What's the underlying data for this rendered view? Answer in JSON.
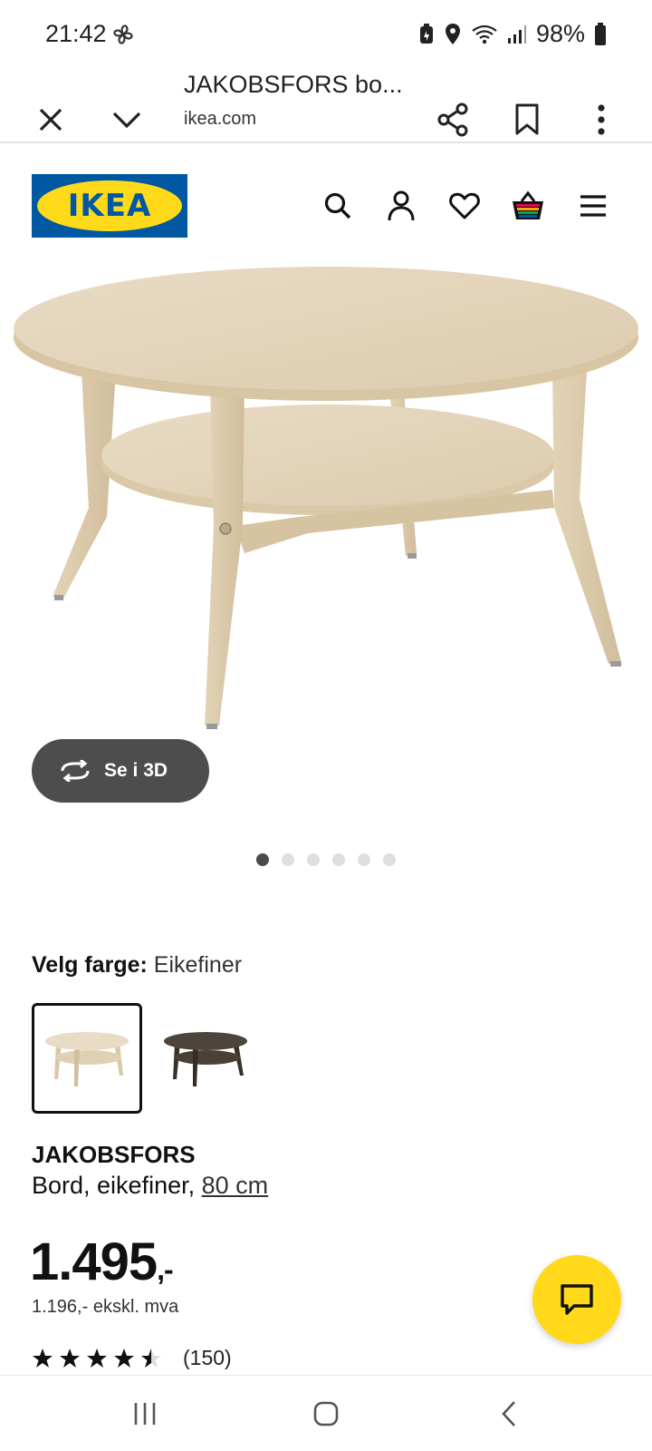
{
  "status_bar": {
    "time": "21:42",
    "battery": "98%"
  },
  "browser": {
    "title": "JAKOBSFORS bo...",
    "url": "ikea.com"
  },
  "brand": {
    "logo_text": "IKEA",
    "blue": "#0058a3",
    "yellow": "#ffda1a"
  },
  "header_icons": [
    "search-icon",
    "account-icon",
    "heart-icon",
    "basket-icon",
    "menu-icon"
  ],
  "product": {
    "view_3d_label": "Se i 3D",
    "image_count": 6,
    "active_image": 1,
    "color_label": "Velg farge:",
    "color_value": "Eikefiner",
    "name": "JAKOBSFORS",
    "desc_prefix": "Bord, eikefiner, ",
    "size": "80 cm",
    "price": "1.495",
    "price_suffix": ",-",
    "price_ex_vat": "1.196,- ekskl. mva",
    "rating": 4.5,
    "rating_max": 5,
    "review_count": "(150)"
  },
  "colors": {
    "chat_fab": "#ffd91a",
    "three_d_button": "#4d4d4d"
  }
}
